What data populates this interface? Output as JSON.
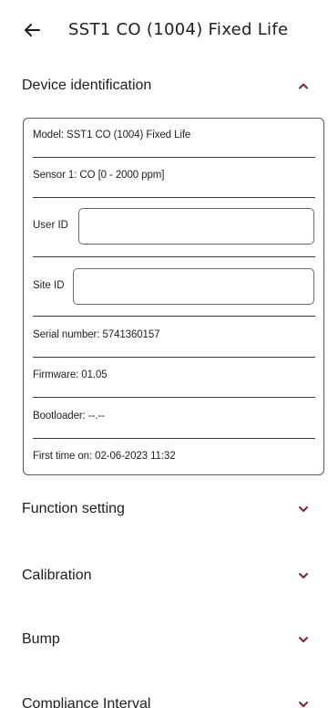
{
  "appbar": {
    "title": "SST1 CO (1004) Fixed Life"
  },
  "sections": {
    "device_identification": {
      "label": "Device identification",
      "expanded": true,
      "model": "Model: SST1 CO (1004) Fixed Life",
      "sensor": "Sensor 1: CO [0 - 2000 ppm]",
      "user_id_label": "User ID",
      "user_id_value": "",
      "site_id_label": "Site ID",
      "site_id_value": "",
      "serial": "Serial number: 5741360157",
      "firmware": "Firmware: 01.05",
      "bootloader": "Bootloader: --.--",
      "first_time_on": "First time on: 02-06-2023 11:32"
    },
    "function_setting": {
      "label": "Function setting"
    },
    "calibration": {
      "label": "Calibration"
    },
    "bump": {
      "label": "Bump"
    },
    "compliance_interval": {
      "label": "Compliance Interval"
    }
  },
  "icons": {
    "back": "arrow-left-icon",
    "collapse": "chevron-up-icon",
    "expand": "chevron-down-icon"
  }
}
